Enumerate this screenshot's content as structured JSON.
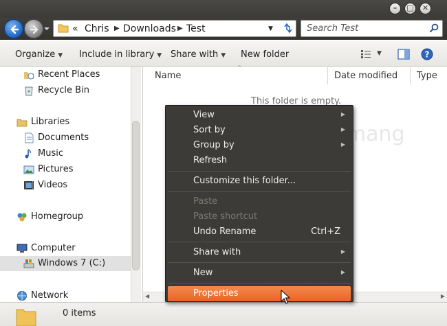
{
  "window": {
    "controls": [
      "–",
      "□",
      "✕"
    ]
  },
  "address": {
    "root_chevron": "«",
    "breadcrumbs": [
      "Chris",
      "Downloads",
      "Test"
    ],
    "search_placeholder": "Search Test"
  },
  "toolbar": {
    "organize": "Organize",
    "include_in_library": "Include in library",
    "share_with": "Share with",
    "new_folder": "New folder"
  },
  "sidebar": {
    "items": [
      {
        "label": "Recent Places",
        "icon": "recent-places-icon"
      },
      {
        "label": "Recycle Bin",
        "icon": "recycle-bin-icon"
      },
      {
        "label": "Libraries",
        "icon": "libraries-icon"
      },
      {
        "label": "Documents",
        "icon": "documents-icon"
      },
      {
        "label": "Music",
        "icon": "music-icon"
      },
      {
        "label": "Pictures",
        "icon": "pictures-icon"
      },
      {
        "label": "Videos",
        "icon": "videos-icon"
      },
      {
        "label": "Homegroup",
        "icon": "homegroup-icon"
      },
      {
        "label": "Computer",
        "icon": "computer-icon"
      },
      {
        "label": "Windows 7 (C:)",
        "icon": "drive-icon"
      },
      {
        "label": "Network",
        "icon": "network-icon"
      }
    ]
  },
  "main": {
    "columns": [
      "Name",
      "Date modified",
      "Type"
    ],
    "empty_message": "This folder is empty."
  },
  "context_menu": {
    "items": [
      {
        "label": "View",
        "submenu": true
      },
      {
        "label": "Sort by",
        "submenu": true
      },
      {
        "label": "Group by",
        "submenu": true
      },
      {
        "label": "Refresh"
      },
      {
        "label": "Customize this folder..."
      },
      {
        "label": "Paste",
        "disabled": true
      },
      {
        "label": "Paste shortcut",
        "disabled": true
      },
      {
        "label": "Undo Rename",
        "shortcut": "Ctrl+Z"
      },
      {
        "label": "Share with",
        "submenu": true
      },
      {
        "label": "New",
        "submenu": true
      },
      {
        "label": "Properties",
        "highlighted": true
      }
    ]
  },
  "status": {
    "item_count": "0 items"
  },
  "watermark": {
    "text": "uantrimang"
  },
  "colors": {
    "menu_bg": "#3c3b37",
    "menu_highlight": "#f07746",
    "title_bg": "#3c3b37"
  }
}
